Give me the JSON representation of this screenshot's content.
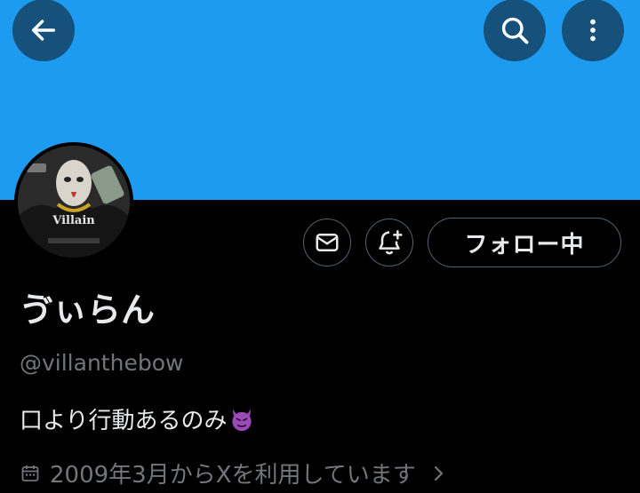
{
  "profile": {
    "display_name": "ゔぃらん",
    "handle": "@villanthebow",
    "bio": "口より行動あるのみ",
    "bio_emoji": "smiling-face-with-horns",
    "joined": "2009年3月からXを利用しています",
    "avatar_text": "Villain"
  },
  "actions": {
    "follow_label": "フォロー中"
  },
  "icons": {
    "back": "arrow-left-icon",
    "search": "search-icon",
    "more": "more-vertical-icon",
    "message": "mail-icon",
    "notify": "bell-plus-icon",
    "calendar": "calendar-icon",
    "chevron": "chevron-right-icon"
  },
  "colors": {
    "banner": "#1d9bf0",
    "background": "#000000",
    "text": "#e7e9ea",
    "secondary": "#71767b",
    "border": "#536471"
  }
}
